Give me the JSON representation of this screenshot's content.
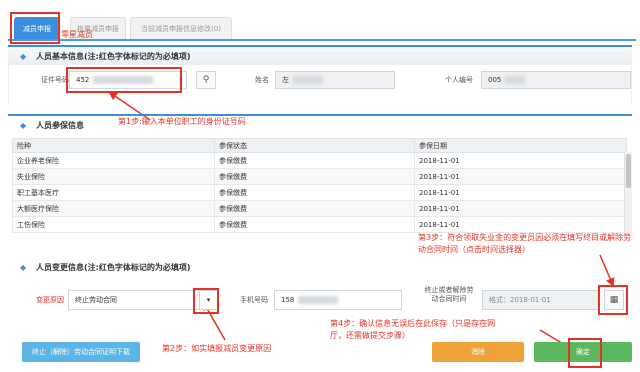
{
  "tabs": [
    {
      "label": "减员申报",
      "active": true
    },
    {
      "label": "批量减员申报",
      "active": false
    },
    {
      "label": "当前减员申报信息修改(0)",
      "active": false
    }
  ],
  "tab_note": "零星减员",
  "basic": {
    "title": "人员基本信息(注:红色字体标记的为必填项)",
    "id_label": "证件号码",
    "id_value": "452",
    "name_label": "姓名",
    "name_value": "左",
    "pno_label": "个人编号",
    "pno_value": "005"
  },
  "insurance": {
    "title": "人员参保信息",
    "headers": [
      "险种",
      "参保状态",
      "参保日期"
    ],
    "rows": [
      [
        "企业养老保险",
        "参保缴费",
        "2018-11-01"
      ],
      [
        "失业保险",
        "参保缴费",
        "2018-11-01"
      ],
      [
        "职工基本医疗",
        "参保缴费",
        "2018-11-01"
      ],
      [
        "大额医疗保险",
        "参保缴费",
        "2018-11-01"
      ],
      [
        "工伤保险",
        "参保缴费",
        "2018-11-01"
      ]
    ]
  },
  "change": {
    "title": "人员变更信息(注:红色字体标记的为必填项)",
    "reason_label": "变更原因",
    "reason_value": "终止劳动合同",
    "phone_label": "手机号码",
    "phone_value": "158",
    "date_label": "终止或者解除劳动合同时间",
    "date_placeholder": "格式：2018-01-01"
  },
  "buttons": {
    "download": "终止（解除）劳动合同证明下载",
    "cancel": "消除",
    "confirm": "确定"
  },
  "annotations": {
    "step1": "第1步:输入本单位职工的身份证号码",
    "step2": "第2步：如实填报减员变更原因",
    "step3": "第3步：符合领取失业金的变更员因必须在填写终目或解除劳动合同时间（点击时间选择器）",
    "step4": "第4步：确认信息无误后在此保存（只是存在网厅，还需做提交步骤）"
  },
  "colors": {
    "accent": "#3b8fde",
    "annotation": "#e53224"
  }
}
